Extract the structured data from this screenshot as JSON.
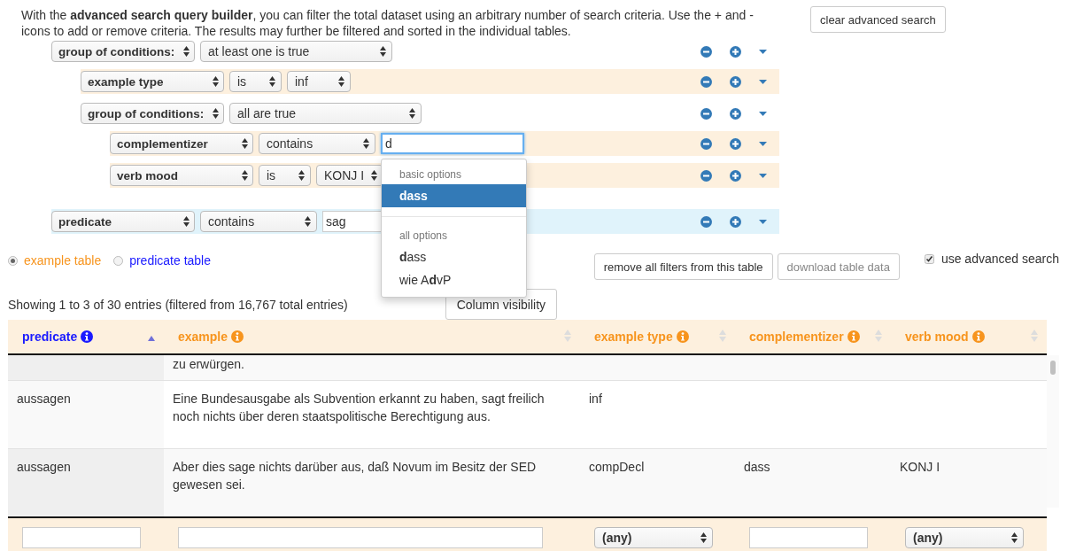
{
  "intro": "With the **advanced search query builder**, you can filter the total dataset using an arbitrary number of search criteria. Use the + and - icons to add or remove criteria. The results may further be filtered and sorted in the individual tables.",
  "clear_button": "clear advanced search",
  "query": [
    {
      "kind": "group",
      "field": "group of conditions:",
      "mode": "at least one is true",
      "children": [
        {
          "kind": "rule",
          "field": "example type",
          "operator": "is",
          "value": {
            "kind": "select",
            "text": "inf"
          },
          "color": "#fdf0de"
        },
        {
          "kind": "group",
          "field": "group of conditions:",
          "mode": "all are true",
          "children": [
            {
              "kind": "rule",
              "field": "complementizer",
              "operator": "contains",
              "value": {
                "kind": "input",
                "text": "d"
              },
              "focused": true,
              "color": "#fdf0de",
              "suggestions": [
                {
                  "heading": "basic options",
                  "items": [
                    {
                      "label": "dass",
                      "selected": true
                    }
                  ]
                },
                {
                  "heading": "all options",
                  "items": [
                    {
                      "label": "**d**ass",
                      "selected": false
                    },
                    {
                      "label": "wie A**d**vP",
                      "selected": false
                    }
                  ]
                }
              ]
            },
            {
              "kind": "rule",
              "field": "verb mood",
              "operator": "is",
              "value": {
                "kind": "select",
                "text": "KONJ I"
              },
              "color": "#fdf0de"
            }
          ]
        }
      ]
    },
    {
      "kind": "rule",
      "field": "predicate",
      "operator": "contains",
      "value": {
        "kind": "input",
        "text": "sag"
      },
      "focused": false,
      "color": "#e0f3fb"
    }
  ],
  "tables": [
    {
      "label": "example table",
      "selected": true,
      "color": "#f7941d"
    },
    {
      "label": "predicate table",
      "selected": false,
      "color": "#1a1aff"
    }
  ],
  "table_buttons": [
    {
      "label": "remove all filters from this table",
      "disabled": false
    },
    {
      "label": "download table data",
      "disabled": true
    }
  ],
  "advanced_checkbox": {
    "label": "use advanced search",
    "checked": true
  },
  "info": "Showing 1 to 3 of 30 entries (filtered from 16,767 total entries)",
  "column_visibility": "Column visibility",
  "table": {
    "columns": [
      {
        "label": "predicate",
        "color": "#1a1aff",
        "sorted": true,
        "filter": {
          "kind": "input"
        }
      },
      {
        "label": "example",
        "color": "#f7941d",
        "sorted": false,
        "filter": {
          "kind": "input"
        }
      },
      {
        "label": "example type",
        "color": "#f7941d",
        "sorted": false,
        "filter": {
          "kind": "select",
          "value": "(any)"
        }
      },
      {
        "label": "complementizer",
        "color": "#f7941d",
        "sorted": false,
        "filter": {
          "kind": "input"
        }
      },
      {
        "label": "verb mood",
        "color": "#f7941d",
        "sorted": false,
        "filter": {
          "kind": "select",
          "value": "(any)"
        }
      }
    ],
    "rows": [
      [
        null,
        "zu erwürgen.",
        null,
        null,
        null
      ],
      [
        "aussagen",
        "Eine Bundesausgabe als Subvention erkannt zu haben, sagt freilich noch nichts über deren staatspolitische Berechtigung aus.",
        "inf",
        null,
        null
      ],
      [
        "aussagen",
        "Aber dies sage nichts darüber aus, daß Novum im Besitz der SED gewesen sei.",
        "compDecl",
        "dass",
        "KONJ I"
      ]
    ]
  }
}
